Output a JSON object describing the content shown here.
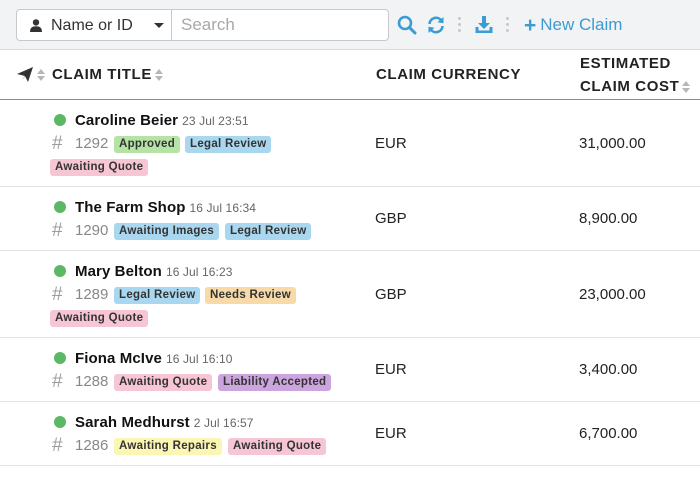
{
  "toolbar": {
    "filter_select": "Name or ID",
    "search_placeholder": "Search",
    "new_claim_label": "New Claim"
  },
  "table": {
    "columns": {
      "title": "CLAIM TITLE",
      "currency": "CLAIM CURRENCY",
      "cost_line1": "ESTIMATED",
      "cost_line2": "CLAIM COST"
    },
    "rows": [
      {
        "name": "Caroline Beier",
        "timestamp": "23 Jul 23:51",
        "id": "1292",
        "tags": [
          "Approved",
          "Legal Review",
          "Awaiting Quote"
        ],
        "currency": "EUR",
        "cost": "31,000.00"
      },
      {
        "name": "The Farm Shop",
        "timestamp": "16 Jul 16:34",
        "id": "1290",
        "tags": [
          "Awaiting Images",
          "Legal Review"
        ],
        "currency": "GBP",
        "cost": "8,900.00"
      },
      {
        "name": "Mary Belton",
        "timestamp": "16 Jul 16:23",
        "id": "1289",
        "tags": [
          "Legal Review",
          "Needs Review",
          "Awaiting Quote"
        ],
        "currency": "GBP",
        "cost": "23,000.00"
      },
      {
        "name": "Fiona McIve",
        "timestamp": "16 Jul 16:10",
        "id": "1288",
        "tags": [
          "Awaiting Quote",
          "Liability Accepted"
        ],
        "currency": "EUR",
        "cost": "3,400.00"
      },
      {
        "name": "Sarah Medhurst",
        "timestamp": "2 Jul 16:57",
        "id": "1286",
        "tags": [
          "Awaiting Repairs",
          "Awaiting Quote"
        ],
        "currency": "EUR",
        "cost": "6,700.00"
      }
    ]
  },
  "colors": {
    "accent": "#3b9bd4",
    "status_dot": "#5db865",
    "tag_approved": "#b5e3a5",
    "tag_legal_review": "#a9d7ef",
    "tag_awaiting_quote": "#f6c6d4",
    "tag_awaiting_images": "#a9d7ef",
    "tag_needs_review": "#f8d9a8",
    "tag_liability_accepted": "#cda5de",
    "tag_awaiting_repairs": "#fbf6b4"
  },
  "icons": {
    "filter_select": "person-icon",
    "search": "search-icon",
    "refresh": "refresh-icon",
    "download": "download-icon",
    "new_claim": "plus-icon",
    "send_column": "paper-plane-icon",
    "status": "status-dot-icon",
    "id_prefix": "hash-icon"
  }
}
